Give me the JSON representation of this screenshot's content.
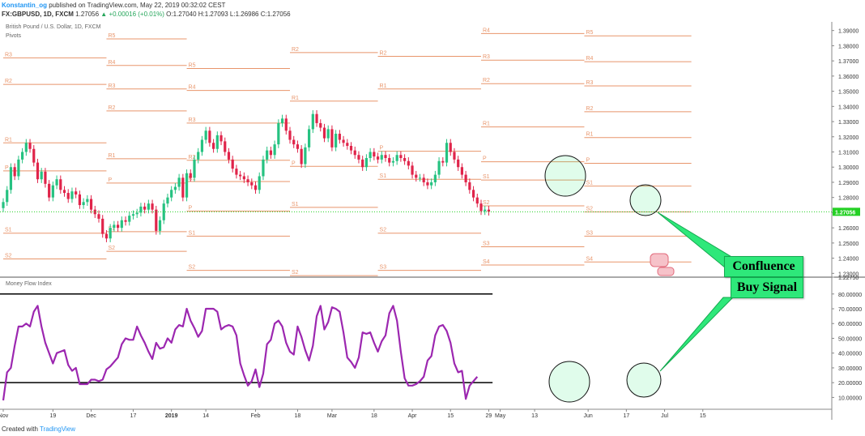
{
  "header": {
    "author": "Konstantin_og",
    "published": "published on TradingView.com, May 22, 2019 00:32:02 CEST",
    "ticker": "FX:GBPUSD, 1D, FXCM",
    "last": "1.27056",
    "change": "▲ +0.00016 (+0.01%)",
    "ohlc": "O:1.27040  H:1.27093  L:1.26986  C:1.27056"
  },
  "overlay": {
    "symbol_title": "British Pound / U.S. Dollar, 1D, FXCM",
    "pivots_label": "Pivots"
  },
  "mfi_label": "Money Flow Index",
  "footer": {
    "prefix": "Created with",
    "brand": "TradingView"
  },
  "callout": {
    "line1": "Confluence",
    "line2": "Buy Signal"
  },
  "colors": {
    "bull": "#26c281",
    "bear": "#e0244a",
    "pivot": "#e8956b",
    "mfi": "#9c27b0",
    "callout": "#2ee87a",
    "last_price": "#24d024"
  },
  "chart_data": [
    {
      "type": "candlestick",
      "title": "British Pound / U.S. Dollar, 1D, FXCM",
      "y_ticks": [
        "1.39000",
        "1.38000",
        "1.37000",
        "1.36000",
        "1.35000",
        "1.34000",
        "1.33000",
        "1.32000",
        "1.31000",
        "1.30000",
        "1.29000",
        "1.28000",
        "1.27000",
        "1.26000",
        "1.25000",
        "1.24000",
        "1.23000",
        "1.22750"
      ],
      "last_price_label": "1.27056",
      "ylim": [
        1.2275,
        1.3925
      ],
      "close": [
        1.277,
        1.285,
        1.3,
        1.294,
        1.305,
        1.31,
        1.316,
        1.312,
        1.303,
        1.292,
        1.297,
        1.289,
        1.28,
        1.288,
        1.292,
        1.285,
        1.283,
        1.279,
        1.284,
        1.282,
        1.275,
        1.277,
        1.279,
        1.272,
        1.269,
        1.266,
        1.256,
        1.253,
        1.26,
        1.262,
        1.26,
        1.265,
        1.264,
        1.268,
        1.269,
        1.27,
        1.274,
        1.272,
        1.276,
        1.272,
        1.258,
        1.265,
        1.276,
        1.28,
        1.285,
        1.287,
        1.293,
        1.28,
        1.296,
        1.293,
        1.305,
        1.31,
        1.318,
        1.324,
        1.316,
        1.312,
        1.321,
        1.317,
        1.31,
        1.305,
        1.299,
        1.295,
        1.294,
        1.292,
        1.29,
        1.288,
        1.285,
        1.294,
        1.305,
        1.311,
        1.308,
        1.315,
        1.329,
        1.332,
        1.324,
        1.318,
        1.315,
        1.312,
        1.302,
        1.313,
        1.325,
        1.335,
        1.329,
        1.326,
        1.319,
        1.325,
        1.313,
        1.322,
        1.318,
        1.316,
        1.314,
        1.311,
        1.308,
        1.305,
        1.3,
        1.306,
        1.31,
        1.307,
        1.305,
        1.308,
        1.306,
        1.303,
        1.304,
        1.308,
        1.306,
        1.304,
        1.301,
        1.295,
        1.293,
        1.293,
        1.29,
        1.288,
        1.29,
        1.295,
        1.304,
        1.303,
        1.316,
        1.31,
        1.305,
        1.3,
        1.295,
        1.29,
        1.285,
        1.28,
        1.276,
        1.271,
        1.272,
        1.2706
      ],
      "x_ticks": [
        {
          "label": "Nov",
          "i": 0
        },
        {
          "label": "19",
          "i": 13
        },
        {
          "label": "Dec",
          "i": 23
        },
        {
          "label": "17",
          "i": 34
        },
        {
          "label": "2019",
          "i": 44
        },
        {
          "label": "14",
          "i": 53
        },
        {
          "label": "Feb",
          "i": 66
        },
        {
          "label": "18",
          "i": 77
        },
        {
          "label": "Mar",
          "i": 86
        },
        {
          "label": "18",
          "i": 97
        },
        {
          "label": "Apr",
          "i": 107
        },
        {
          "label": "15",
          "i": 117
        },
        {
          "label": "29",
          "i": 127
        },
        {
          "label": "May",
          "i": 130
        },
        {
          "label": "13",
          "i": 139
        },
        {
          "label": "Jun",
          "i": 153
        },
        {
          "label": "17",
          "i": 163
        },
        {
          "label": "Jul",
          "i": 173
        },
        {
          "label": "15",
          "i": 183
        }
      ],
      "pivot_label_colors": "pivot"
    },
    {
      "type": "line",
      "title": "Money Flow Index",
      "y_ticks": [
        "80.00000",
        "70.00000",
        "60.00000",
        "50.00000",
        "40.00000",
        "30.00000",
        "20.00000",
        "10.00000"
      ],
      "ylim": [
        2,
        87
      ],
      "bands": [
        80,
        20
      ],
      "values": [
        8,
        27,
        30,
        45,
        58,
        58,
        60,
        58,
        68,
        72,
        58,
        47,
        40,
        33,
        40,
        41,
        42,
        32,
        28,
        30,
        19,
        19,
        19,
        22,
        22,
        21,
        22,
        29,
        31,
        34,
        37,
        46,
        50,
        49,
        49,
        58,
        52,
        47,
        41,
        36,
        47,
        43,
        44,
        50,
        47,
        56,
        59,
        58,
        70,
        62,
        57,
        51,
        55,
        70,
        70,
        70,
        68,
        56,
        58,
        59,
        58,
        52,
        33,
        25,
        18,
        21,
        29,
        17,
        26,
        46,
        49,
        60,
        62,
        58,
        47,
        41,
        39,
        58,
        51,
        42,
        35,
        45,
        65,
        72,
        56,
        61,
        71,
        70,
        68,
        54,
        37,
        34,
        30,
        37,
        54,
        53,
        54,
        47,
        41,
        48,
        52,
        67,
        72,
        62,
        41,
        23,
        18,
        18,
        19,
        21,
        24,
        35,
        38,
        52,
        58,
        59,
        55,
        47,
        33,
        27,
        28,
        9,
        18,
        21,
        24
      ],
      "start_index": 0
    }
  ]
}
